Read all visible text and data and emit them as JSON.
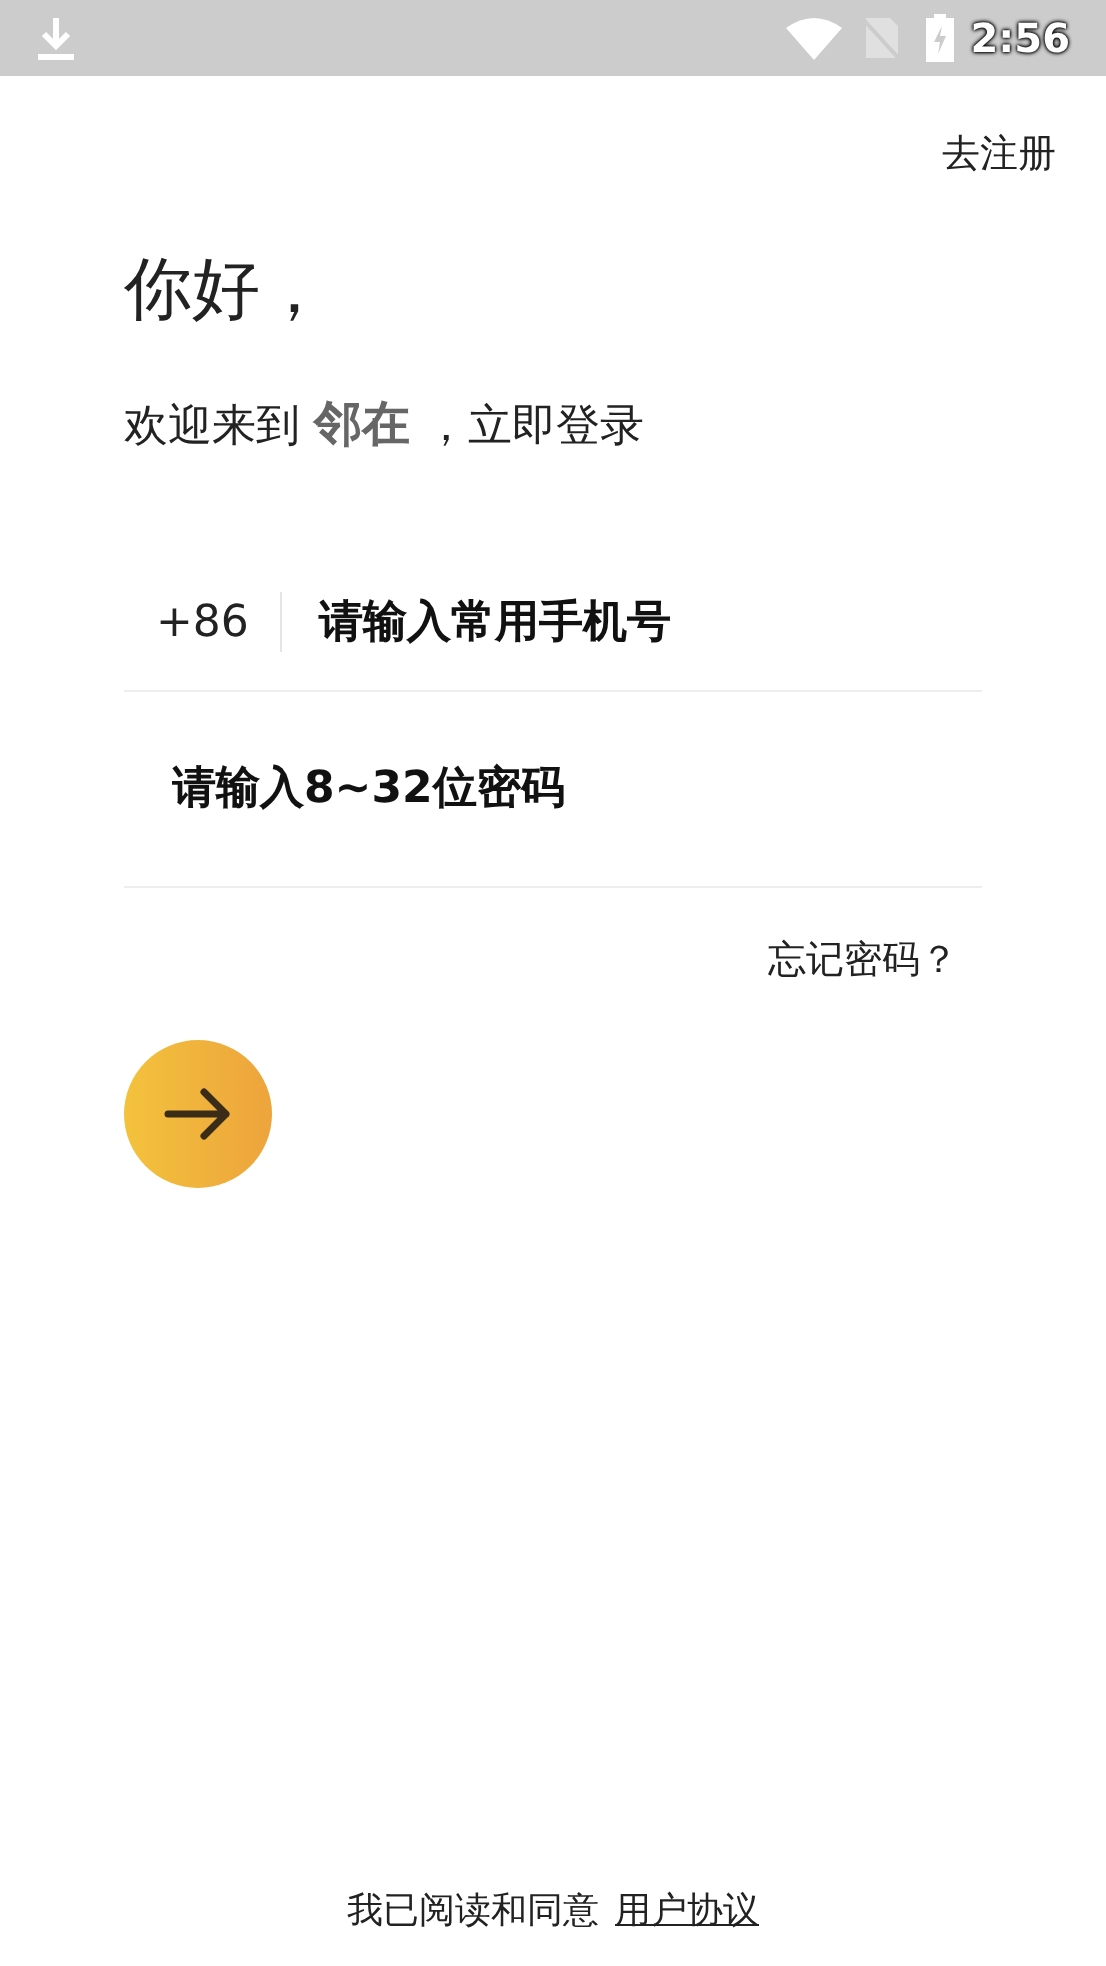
{
  "status_bar": {
    "time": "2:56"
  },
  "register_link": "去注册",
  "greeting": "你好，",
  "welcome": "欢迎来到 **邻在** ，立即登录",
  "phone": {
    "country_code": "+86",
    "placeholder": "请输入常用手机号"
  },
  "password": {
    "placeholder": "请输入8~32位密码"
  },
  "forgot_link": "忘记密码？",
  "agreement": {
    "text": "我已阅读和同意",
    "link": "用户协议"
  }
}
